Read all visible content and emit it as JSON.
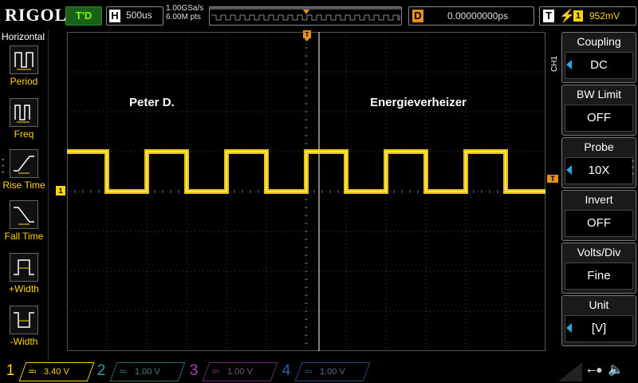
{
  "brand": "RIGOL",
  "top": {
    "run_status": "T'D",
    "horizontal_label": "H",
    "timebase": "500us",
    "sample_rate": "1.00GSa/s",
    "memory_depth": "6.00M pts",
    "delay_label": "D",
    "delay_value": "0.00000000ps",
    "trigger_label": "T",
    "trigger_source": "1",
    "trigger_level": "952mV"
  },
  "left_menu": {
    "title": "Horizontal",
    "items": [
      {
        "label": "Period",
        "icon": "period-icon"
      },
      {
        "label": "Freq",
        "icon": "freq-icon"
      },
      {
        "label": "Rise Time",
        "icon": "rise-time-icon"
      },
      {
        "label": "Fall Time",
        "icon": "fall-time-icon"
      },
      {
        "label": "+Width",
        "icon": "positive-width-icon"
      },
      {
        "label": "-Width",
        "icon": "negative-width-icon"
      }
    ]
  },
  "screen": {
    "annotation_left": "Peter D.",
    "annotation_right": "Energieverheizer",
    "ch1_marker": "1",
    "trigger_marker": "T",
    "channel_side_label": "CH1"
  },
  "right_menu": {
    "items": [
      {
        "title": "Coupling",
        "value": "DC",
        "has_arrow": true
      },
      {
        "title": "BW Limit",
        "value": "OFF",
        "has_arrow": false
      },
      {
        "title": "Probe",
        "value": "10X",
        "has_arrow": true
      },
      {
        "title": "Invert",
        "value": "OFF",
        "has_arrow": false
      },
      {
        "title": "Volts/Div",
        "value": "Fine",
        "has_arrow": false
      },
      {
        "title": "Unit",
        "value": "[V]",
        "has_arrow": true
      }
    ]
  },
  "channels": [
    {
      "num": "1",
      "value": "3.40 V",
      "color": "#ffd700",
      "active": true
    },
    {
      "num": "2",
      "value": "1.00 V",
      "color": "#2a9d9d",
      "active": false
    },
    {
      "num": "3",
      "value": "1.00 V",
      "color": "#b03ab0",
      "active": false
    },
    {
      "num": "4",
      "value": "1.00 V",
      "color": "#2a5fb0",
      "active": false
    }
  ],
  "colors": {
    "ch1": "#ffd700",
    "trigger": "#e8901a",
    "grid": "#444444",
    "run_status": "#1a5f1a"
  },
  "icons": {
    "usb": "usb-icon",
    "speaker": "speaker-icon"
  },
  "waveform": {
    "type": "square",
    "high_div": 3.0,
    "low_div": 2.0,
    "period_div": 2.0,
    "start_high": true
  }
}
